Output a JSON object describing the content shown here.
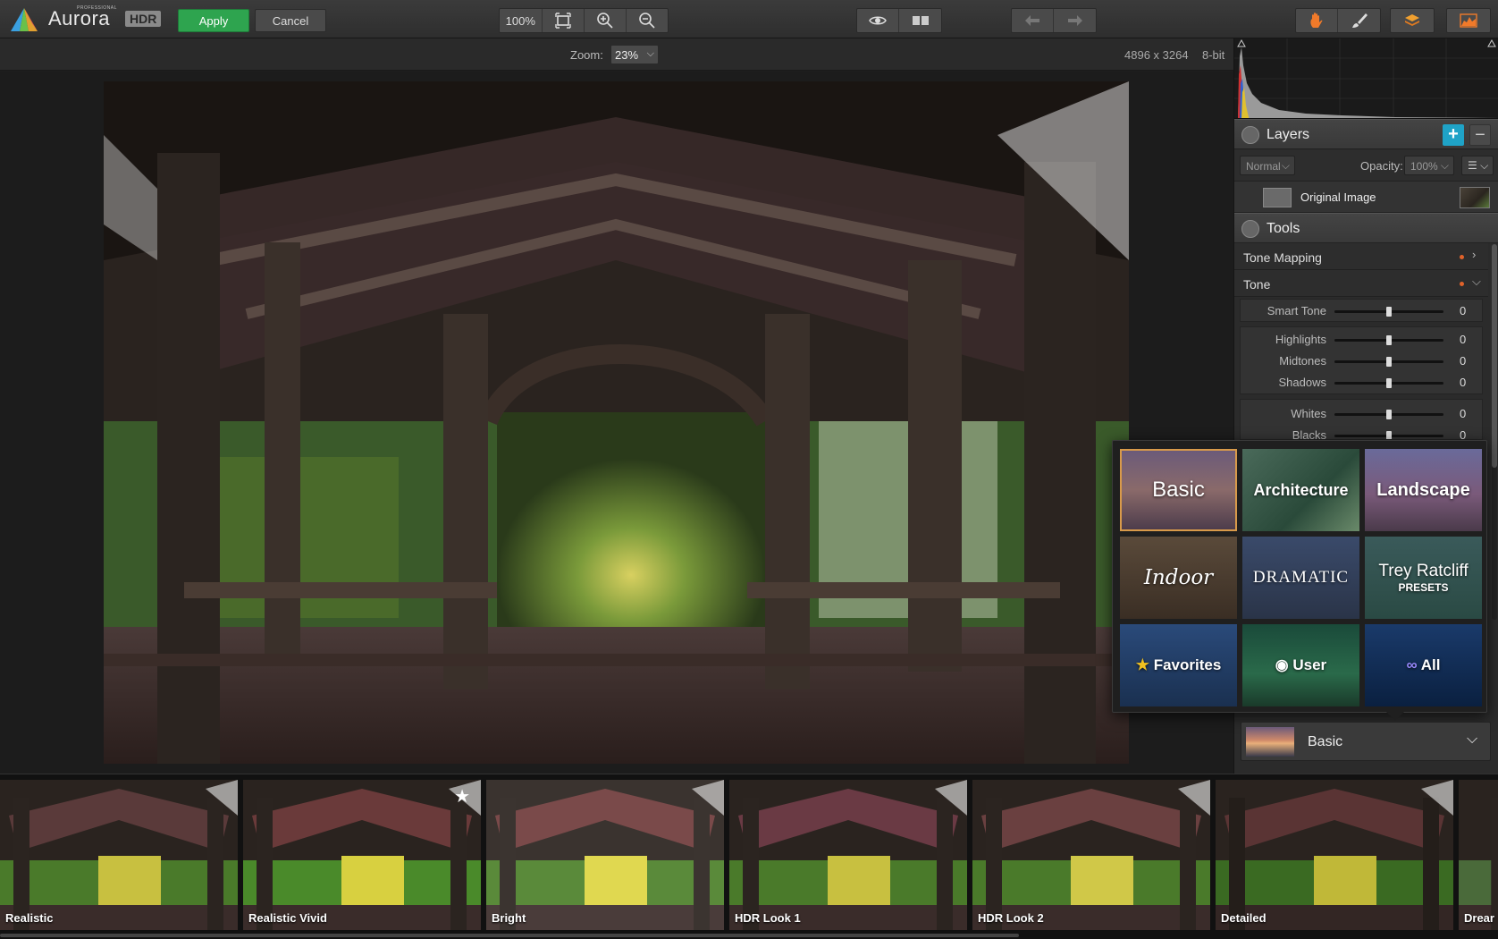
{
  "toolbar": {
    "app_name": "Aurora",
    "app_badge": "HDR",
    "app_tagline": "PROFESSIONAL",
    "apply_label": "Apply",
    "cancel_label": "Cancel",
    "zoom_100_label": "100%"
  },
  "zoombar": {
    "zoom_label": "Zoom:",
    "zoom_value": "23%",
    "dimensions": "4896 x 3264",
    "bit_depth": "8-bit"
  },
  "layers": {
    "title": "Layers",
    "add_label": "+",
    "remove_label": "−",
    "blend_mode": "Normal",
    "opacity_label": "Opacity:",
    "opacity_value": "100%",
    "layer_name": "Original Image"
  },
  "tools": {
    "title": "Tools",
    "tone_mapping_label": "Tone Mapping",
    "tone_label": "Tone",
    "sliders": [
      {
        "label": "Smart Tone",
        "value": "0",
        "fraction": 0.5
      },
      {
        "label": "Highlights",
        "value": "0",
        "fraction": 0.5
      },
      {
        "label": "Midtones",
        "value": "0",
        "fraction": 0.5
      },
      {
        "label": "Shadows",
        "value": "0",
        "fraction": 0.5
      },
      {
        "label": "Whites",
        "value": "0",
        "fraction": 0.5
      },
      {
        "label": "Blacks",
        "value": "0",
        "fraction": 0.5
      }
    ]
  },
  "presets": {
    "categories": [
      {
        "name": "Basic"
      },
      {
        "name": "Architecture"
      },
      {
        "name": "Landscape"
      },
      {
        "name": "Indoor"
      },
      {
        "name": "DRAMATIC"
      },
      {
        "name": "Trey Ratcliff",
        "sub": "PRESETS"
      },
      {
        "name": "Favorites"
      },
      {
        "name": "User"
      },
      {
        "name": "All"
      }
    ],
    "selected": "Basic"
  },
  "filmstrip": [
    {
      "name": "Realistic"
    },
    {
      "name": "Realistic Vivid"
    },
    {
      "name": "Bright"
    },
    {
      "name": "HDR Look 1"
    },
    {
      "name": "HDR Look 2"
    },
    {
      "name": "Detailed"
    },
    {
      "name": "Drear"
    }
  ],
  "colors": {
    "apply": "#2ea44f",
    "accent": "#1fa3c7",
    "modified_dot": "#e0622a",
    "selected_tile": "#d89a4a"
  }
}
